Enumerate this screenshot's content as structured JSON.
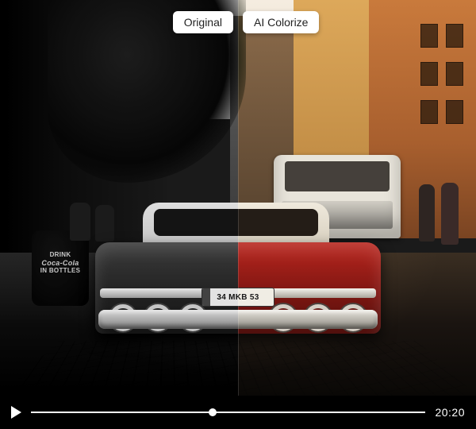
{
  "comparison": {
    "left_label": "Original",
    "right_label": "AI Colorize",
    "divider_position_percent": 50
  },
  "scene": {
    "license_plate": "34 MKB 53",
    "barrel_line1": "DRINK",
    "barrel_line2": "Coca-Cola",
    "barrel_line3": "IN BOTTLES"
  },
  "player": {
    "state": "paused",
    "progress_percent": 46,
    "duration_label": "20:20"
  },
  "colors": {
    "car_body": "#b9261e",
    "building_orange": "#c97a3c",
    "label_bg": "#ffffff",
    "controls_fg": "#ffffff"
  }
}
